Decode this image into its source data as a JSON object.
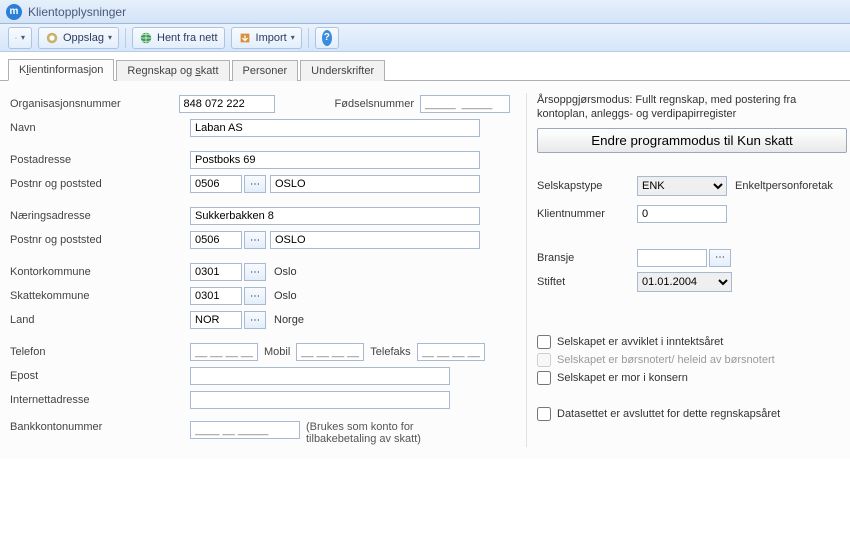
{
  "window": {
    "title": "Klientopplysninger"
  },
  "toolbar": {
    "oppslag": "Oppslag",
    "hent": "Hent fra nett",
    "import": "Import"
  },
  "tabs": {
    "t1_pre": "K",
    "t1_u": "l",
    "t1_post": "ientinformasjon",
    "t2": "Regnskap og skatt",
    "t2_u": "s",
    "t3": "Personer",
    "t4": "Underskrifter"
  },
  "labels": {
    "orgnr": "Organisasjonsnummer",
    "fodsel": "Fødselsnummer",
    "navn": "Navn",
    "postadr": "Postadresse",
    "postnr": "Postnr og poststed",
    "neradr": "Næringsadresse",
    "kontor": "Kontorkommune",
    "skatte": "Skattekommune",
    "land": "Land",
    "telefon": "Telefon",
    "mobil": "Mobil",
    "telefaks": "Telefaks",
    "epost": "Epost",
    "internett": "Internettadresse",
    "bank": "Bankkontonummer",
    "bank_note": "(Brukes som konto for tilbakebetaling av skatt)",
    "arsopp": "Årsoppgjørsmodus: Fullt regnskap, med postering fra kontoplan, anleggs- og verdipapirregister",
    "endre_btn": "Endre programmodus til Kun skatt",
    "selskapstype": "Selskapstype",
    "enk_desc": "Enkeltpersonforetak",
    "klientnr": "Klientnummer",
    "bransje": "Bransje",
    "stiftet": "Stiftet",
    "c1": "Selskapet er avviklet i inntektsåret",
    "c2": "Selskapet er børsnotert/ heleid av børsnotert",
    "c3": "Selskapet er mor i konsern",
    "c4": "Datasettet er avsluttet for dette regnskapsåret"
  },
  "values": {
    "orgnr": "848 072 222",
    "fodsel_ph": "_____  _____",
    "navn": "Laban AS",
    "postadr": "Postboks 69",
    "postnr1": "0506",
    "poststed1": "OSLO",
    "neradr": "Sukkerbakken 8",
    "postnr2": "0506",
    "poststed2": "OSLO",
    "kontor_code": "0301",
    "kontor_name": "Oslo",
    "skatte_code": "0301",
    "skatte_name": "Oslo",
    "land_code": "NOR",
    "land_name": "Norge",
    "tel_ph": "__ __ __ __",
    "bank_ph": "____ __ _____",
    "selskapstype": "ENK",
    "klientnr": "0",
    "bransje": "",
    "stiftet": "01.01.2004"
  }
}
